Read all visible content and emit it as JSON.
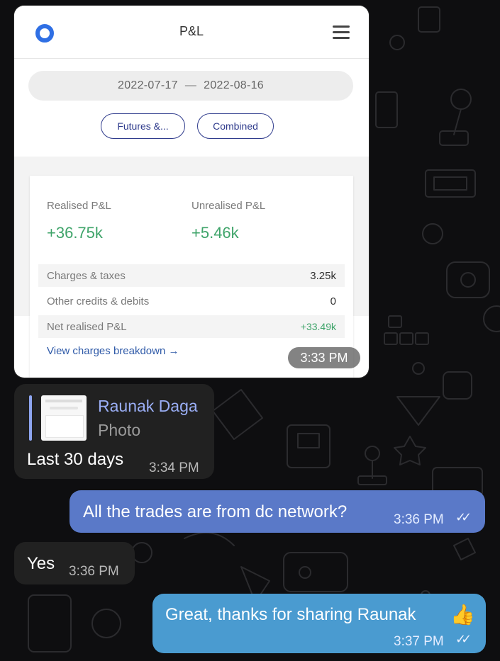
{
  "pnl_screenshot": {
    "header": {
      "title": "P&L",
      "logo_color": "#2f6fe4",
      "menu_icon": "hamburger-menu-icon"
    },
    "date_range": {
      "start": "2022-07-17",
      "separator": "—",
      "end": "2022-08-16"
    },
    "filters": [
      {
        "label": "Futures &..."
      },
      {
        "label": "Combined"
      }
    ],
    "metrics": {
      "realised": {
        "label": "Realised P&L",
        "value": "+36.75k"
      },
      "unrealised": {
        "label": "Unrealised P&L",
        "value": "+5.46k"
      }
    },
    "rows": [
      {
        "label": "Charges & taxes",
        "value": "3.25k"
      },
      {
        "label": "Other credits & debits",
        "value": "0"
      },
      {
        "label": "Net realised P&L",
        "value": "+33.49k"
      }
    ],
    "breakdown_link": "View charges breakdown →",
    "positive_color": "#3fa46a",
    "timestamp": "3:33 PM"
  },
  "messages": [
    {
      "direction": "incoming",
      "reply_to": {
        "sender": "Raunak Daga",
        "kind": "Photo"
      },
      "text": "Last 30 days",
      "time": "3:34 PM"
    },
    {
      "direction": "outgoing",
      "text": "All the trades are from dc network?",
      "time": "3:36 PM",
      "status": "read"
    },
    {
      "direction": "incoming",
      "text": "Yes",
      "time": "3:36 PM"
    },
    {
      "direction": "outgoing",
      "text": "Great, thanks for sharing Raunak",
      "emoji": "👍",
      "time": "3:37 PM",
      "status": "read"
    }
  ],
  "colors": {
    "background": "#0e0e10",
    "incoming_bubble": "#212121",
    "outgoing_bubble": "#5a79c8",
    "outgoing_bubble_alt": "#4a9bd0",
    "reply_accent": "#9aaef5"
  }
}
